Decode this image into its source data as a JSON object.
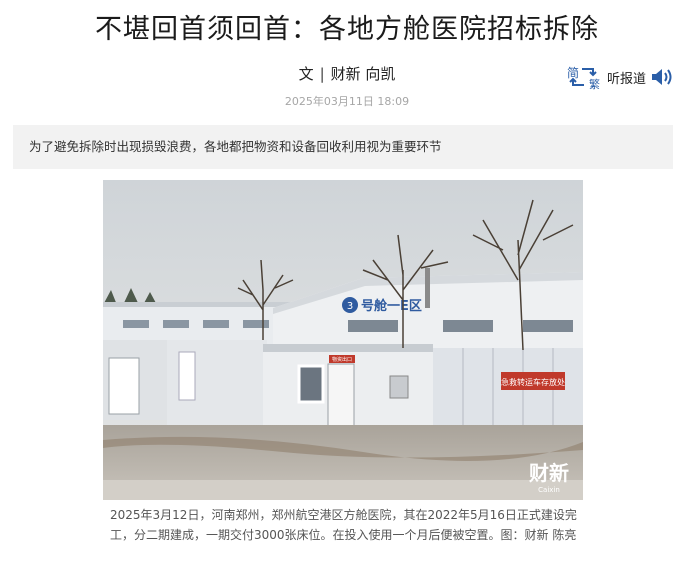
{
  "article": {
    "title": "不堪回首须回首：各地方舱医院招标拆除",
    "byline_prefix": "文",
    "byline_separator": "|",
    "byline_author": "财新 向凯",
    "date": "2025年03月11日 18:09",
    "summary": "为了避免拆除时出现损毁浪费，各地都把物资和设备回收利用视为重要环节"
  },
  "toolbar": {
    "simplified_char": "简",
    "traditional_char": "繁",
    "listen_label": "听报道",
    "accent_color": "#2a5ea8"
  },
  "photo": {
    "sign_text": "③号舱一E区",
    "banner_red": "急救转运车存放处",
    "small_sign": "物资出口",
    "watermark": "财新",
    "watermark_sub": "Caixin",
    "caption": "2025年3月12日，河南郑州，郑州航空港区方舱医院，其在2022年5月16日正式建设完工，分二期建成，一期交付3000张床位。在投入使用一个月后便被空置。图：财新 陈亮"
  }
}
